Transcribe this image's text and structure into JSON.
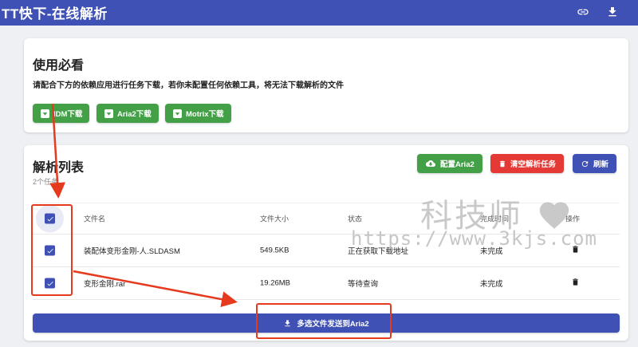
{
  "header": {
    "title": "TT快下-在线解析",
    "icons": [
      "link-icon",
      "download-icon"
    ]
  },
  "usage_card": {
    "heading": "使用必看",
    "subtext": "请配合下方的依赖应用进行任务下载，若你未配置任何依赖工具，将无法下载解析的文件",
    "buttons": [
      "IDM下载",
      "Aria2下载",
      "Motrix下载"
    ]
  },
  "list_card": {
    "heading": "解析列表",
    "count": "2个任务",
    "actions": {
      "config_aria2": "配置Aria2",
      "clear_tasks": "清空解析任务",
      "refresh": "刷新"
    },
    "columns": [
      "文件名",
      "文件大小",
      "状态",
      "完成时间",
      "操作"
    ],
    "rows": [
      {
        "name": "装配体变形金刚-人.SLDASM",
        "size": "549.5KB",
        "status": "正在获取下载地址",
        "done": "未完成"
      },
      {
        "name": "变形金刚.rar",
        "size": "19.26MB",
        "status": "等待查询",
        "done": "未完成"
      }
    ],
    "send_button": "多选文件发送到Aria2"
  },
  "watermark": {
    "title": "科技师",
    "url": "https://www.3kjs.com"
  },
  "colors": {
    "primary": "#3f51b5",
    "green": "#43a047",
    "red": "#e53935",
    "annotation": "#e53a1e"
  }
}
